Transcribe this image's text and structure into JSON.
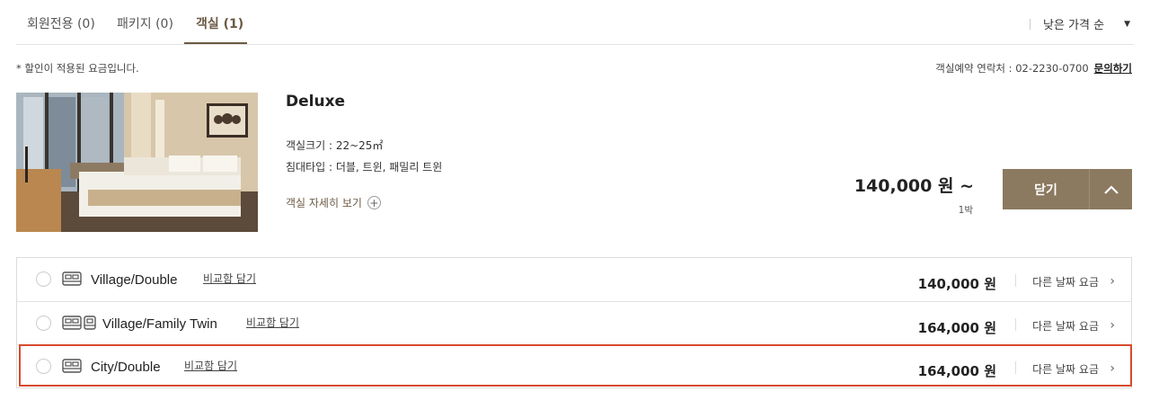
{
  "tabs": [
    {
      "label": "회원전용 (0)"
    },
    {
      "label": "패키지 (0)"
    },
    {
      "label": "객실 (1)"
    }
  ],
  "sort": {
    "label": "낮은 가격 순"
  },
  "notice": "* 할인이 적용된 요금입니다.",
  "contact": {
    "text": "객실예약 연락처 : 02-2230-0700",
    "link": "문의하기"
  },
  "room": {
    "title": "Deluxe",
    "size": "객실크기 : 22~25㎡",
    "bed_type": "침대타입 : 더블, 트윈, 패밀리 트윈",
    "detail_link": "객실 자세히 보기",
    "price": "140,000 원 ~",
    "per_night": "1박",
    "close_label": "닫기"
  },
  "rates": [
    {
      "name": "Village/Double",
      "compare": "비교함 담기",
      "price": "140,000 원",
      "other": "다른 날짜 요금"
    },
    {
      "name": "Village/Family Twin",
      "compare": "비교함 담기",
      "price": "164,000 원",
      "other": "다른 날짜 요금"
    },
    {
      "name": "City/Double",
      "compare": "비교함 담기",
      "price": "164,000 원",
      "other": "다른 날짜 요금"
    }
  ],
  "colors": {
    "accent": "#6b5a44",
    "button": "#8b7960",
    "highlight": "#d84a2e"
  }
}
